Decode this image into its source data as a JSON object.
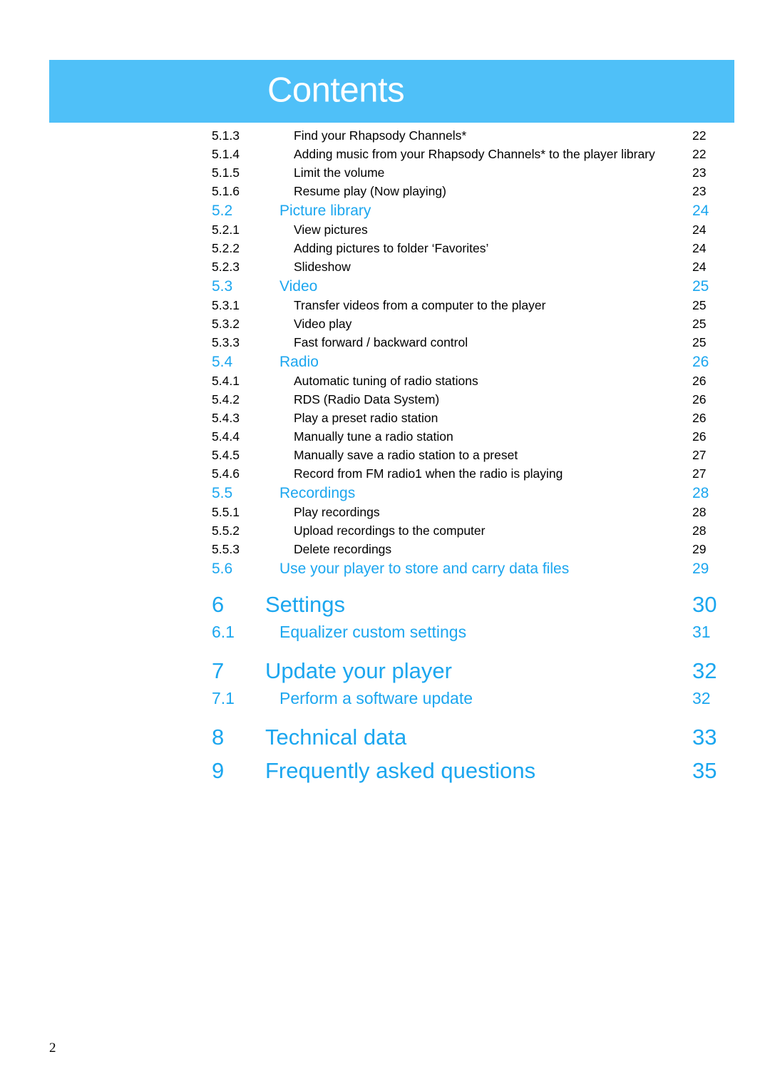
{
  "banner": {
    "title": "Contents",
    "background_color": "#4FC0F8",
    "text_color": "#FFFFFF"
  },
  "accent_color": "#1BA6EF",
  "body_text_color": "#000000",
  "footer": {
    "page_number": "2"
  },
  "toc": {
    "entries": [
      {
        "level": "sub",
        "num": "5.1.3",
        "title": "Find your Rhapsody Channels*",
        "page": "22"
      },
      {
        "level": "sub",
        "num": "5.1.4",
        "title": "Adding music from your Rhapsody Channels* to the player library",
        "page": "22"
      },
      {
        "level": "sub",
        "num": "5.1.5",
        "title": "Limit the volume",
        "page": "23"
      },
      {
        "level": "sub",
        "num": "5.1.6",
        "title": "Resume play (Now playing)",
        "page": "23"
      },
      {
        "level": "section",
        "num": "5.2",
        "title": "Picture library",
        "page": "24"
      },
      {
        "level": "sub",
        "num": "5.2.1",
        "title": "View pictures",
        "page": "24"
      },
      {
        "level": "sub",
        "num": "5.2.2",
        "title": "Adding pictures to folder ‘Favorites’",
        "page": "24"
      },
      {
        "level": "sub",
        "num": "5.2.3",
        "title": "Slideshow",
        "page": "24"
      },
      {
        "level": "section",
        "num": "5.3",
        "title": "Video",
        "page": "25"
      },
      {
        "level": "sub",
        "num": "5.3.1",
        "title": "Transfer videos from a computer to the player",
        "page": "25"
      },
      {
        "level": "sub",
        "num": "5.3.2",
        "title": "Video play",
        "page": "25"
      },
      {
        "level": "sub",
        "num": "5.3.3",
        "title": "Fast forward / backward control",
        "page": "25"
      },
      {
        "level": "section",
        "num": "5.4",
        "title": "Radio",
        "page": "26"
      },
      {
        "level": "sub",
        "num": "5.4.1",
        "title": "Automatic tuning of radio stations",
        "page": "26"
      },
      {
        "level": "sub",
        "num": "5.4.2",
        "title": "RDS (Radio Data System)",
        "page": "26"
      },
      {
        "level": "sub",
        "num": "5.4.3",
        "title": "Play a preset radio station",
        "page": "26"
      },
      {
        "level": "sub",
        "num": "5.4.4",
        "title": "Manually tune a radio station",
        "page": "26"
      },
      {
        "level": "sub",
        "num": "5.4.5",
        "title": "Manually save a radio station to a preset",
        "page": "27"
      },
      {
        "level": "sub",
        "num": "5.4.6",
        "title": "Record from FM radio1 when the radio is playing",
        "page": "27"
      },
      {
        "level": "section",
        "num": "5.5",
        "title": "Recordings",
        "page": "28"
      },
      {
        "level": "sub",
        "num": "5.5.1",
        "title": "Play recordings",
        "page": "28"
      },
      {
        "level": "sub",
        "num": "5.5.2",
        "title": "Upload recordings to the computer",
        "page": "28"
      },
      {
        "level": "sub",
        "num": "5.5.3",
        "title": "Delete recordings",
        "page": "29"
      },
      {
        "level": "section",
        "num": "5.6",
        "title": "Use your player to store and carry data files",
        "page": "29"
      },
      {
        "level": "chapter",
        "num": "6",
        "title": "Settings",
        "page": "30",
        "gap": "md"
      },
      {
        "level": "subchapter",
        "num": "6.1",
        "title": "Equalizer custom settings",
        "page": "31"
      },
      {
        "level": "chapter",
        "num": "7",
        "title": "Update your player",
        "page": "32",
        "gap": "md"
      },
      {
        "level": "subchapter",
        "num": "7.1",
        "title": "Perform a software update",
        "page": "32"
      },
      {
        "level": "chapter",
        "num": "8",
        "title": "Technical data",
        "page": "33",
        "gap": "md"
      },
      {
        "level": "chapter",
        "num": "9",
        "title": "Frequently asked questions",
        "page": "35",
        "gap": "sm"
      }
    ]
  }
}
